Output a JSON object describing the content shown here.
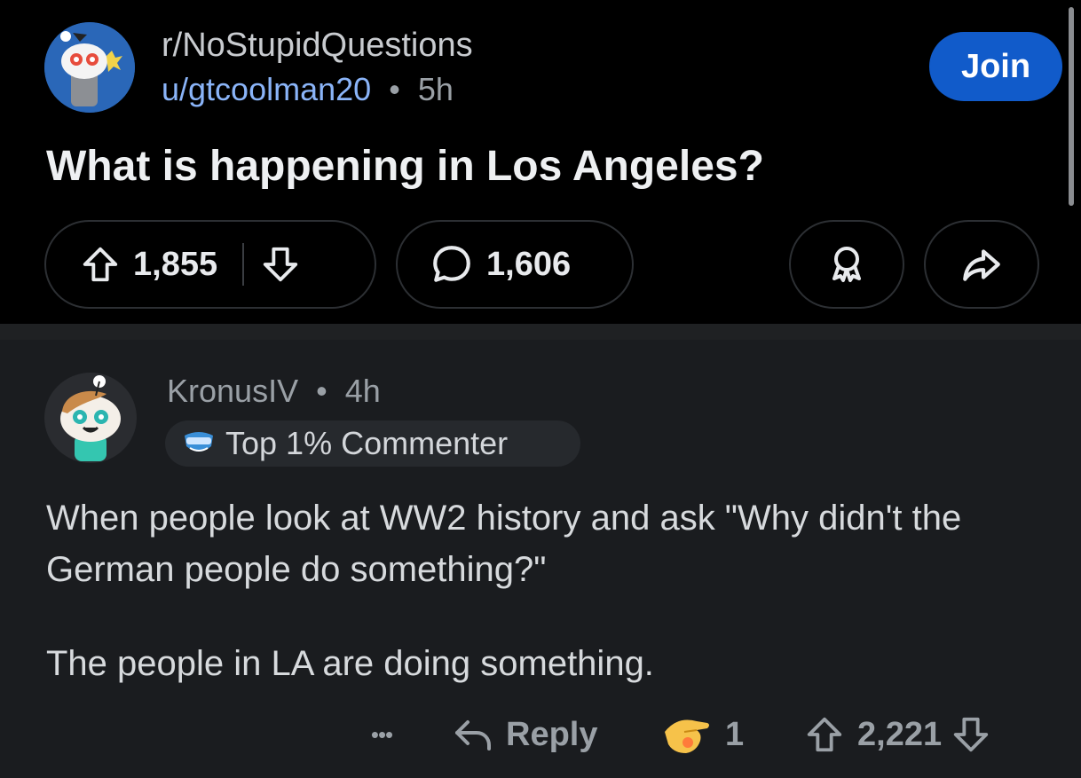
{
  "post": {
    "subreddit": "r/NoStupidQuestions",
    "author": "u/gtcoolman20",
    "separator": "•",
    "age": "5h",
    "join_label": "Join",
    "title": "What is happening in Los Angeles?",
    "upvotes": "1,855",
    "comments": "1,606"
  },
  "comment": {
    "author": "KronusIV",
    "separator": "•",
    "age": "4h",
    "badge": "Top 1% Commenter",
    "body": [
      "When people look at WW2 history and ask \"Why didn't the German people do something?\"",
      "The people in LA are doing something."
    ],
    "more": "•••",
    "reply_label": "Reply",
    "award_count": "1",
    "votes": "2,221"
  },
  "icons": {
    "upvote": "arrow-up-outline-icon",
    "downvote": "arrow-down-outline-icon",
    "comment": "speech-bubble-icon",
    "award": "award-ribbon-icon",
    "share": "share-arrow-icon",
    "reply": "reply-arrow-icon",
    "badge": "commenter-badge-icon",
    "award_given": "pointing-hand-award-icon"
  },
  "colors": {
    "post_bg": "#000000",
    "comment_bg": "#1a1c1f",
    "join_button": "#115bca",
    "username_link": "#8ab4f8",
    "muted_text": "#9aa0a6"
  }
}
